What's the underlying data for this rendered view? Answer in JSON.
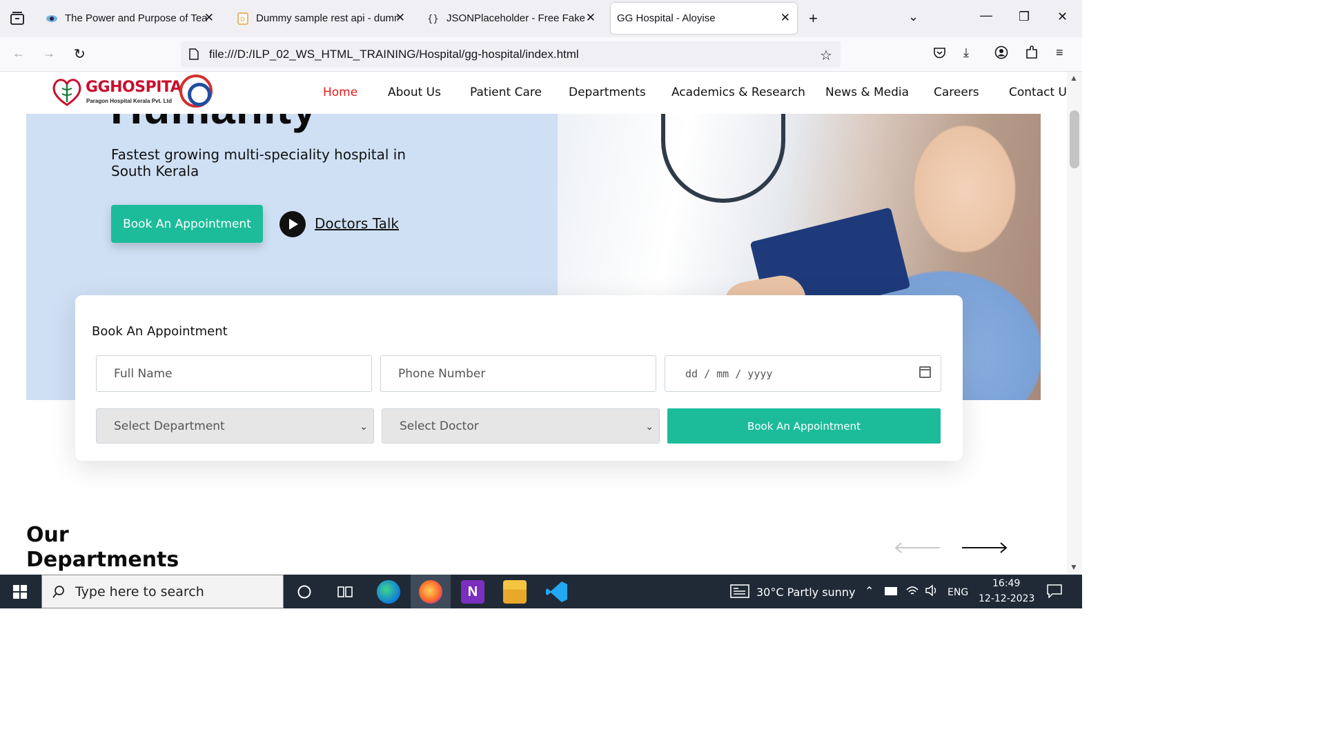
{
  "browser": {
    "tabs": [
      {
        "title": "The Power and Purpose of Team",
        "active": false
      },
      {
        "title": "Dummy sample rest api - dumm",
        "active": false
      },
      {
        "title": "JSONPlaceholder - Free Fake RE",
        "active": false
      },
      {
        "title": "GG Hospital - Aloyise",
        "active": true
      }
    ],
    "url": "file:///D:/ILP_02_WS_HTML_TRAINING/Hospital/gg-hospital/index.html"
  },
  "site": {
    "logo": {
      "name": "GGHOSPITAL",
      "subtitle": "Paragon Hospital Kerala Pvt. Ltd"
    },
    "nav": [
      {
        "label": "Home",
        "active": true
      },
      {
        "label": "About Us",
        "active": false
      },
      {
        "label": "Patient Care",
        "active": false
      },
      {
        "label": "Departments",
        "active": false
      },
      {
        "label": "Academics & Research",
        "active": false
      },
      {
        "label": "News & Media",
        "active": false
      },
      {
        "label": "Careers",
        "active": false
      },
      {
        "label": "Contact Us",
        "active": false
      }
    ],
    "hero": {
      "headline_tail": "Humanity",
      "subtitle": "Fastest growing multi-speciality hospital in South Kerala",
      "cta": "Book An Appointment",
      "video_link": "Doctors Talk"
    },
    "appointment": {
      "title": "Book An Appointment",
      "full_name_placeholder": "Full Name",
      "phone_placeholder": "Phone Number",
      "date_placeholder": "dd / mm / yyyy",
      "department_select": "Select Department",
      "doctor_select": "Select Doctor",
      "submit": "Book An Appointment"
    },
    "departments": {
      "title_line1": "Our",
      "title_line2": "Departments"
    }
  },
  "taskbar": {
    "search_placeholder": "Type here to search",
    "weather": "30°C  Partly sunny",
    "language": "ENG",
    "time": "16:49",
    "date": "12-12-2023"
  },
  "colors": {
    "accent": "#1cbc9b",
    "nav_active": "#e11b1b",
    "hero_bg": "#cfe0f4",
    "taskbar": "#1f2a36"
  }
}
